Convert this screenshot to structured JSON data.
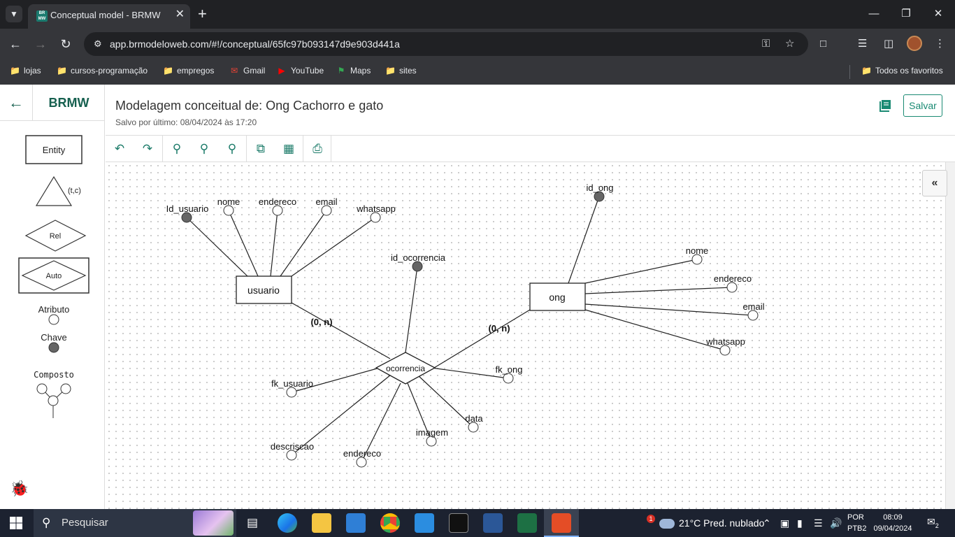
{
  "browser": {
    "tab_title": "Conceptual model - BRMW",
    "url": "app.brmodeloweb.com/#!/conceptual/65fc97b093147d9e903d441a",
    "bookmarks": [
      "lojas",
      "cursos-programação",
      "empregos",
      "Gmail",
      "YouTube",
      "Maps",
      "sites"
    ],
    "all_bookmarks": "Todos os favoritos"
  },
  "app": {
    "brand": "BRMW",
    "title": "Modelagem conceitual de: Ong Cachorro e gato",
    "subtitle": "Salvo por último: 08/04/2024 às 17:20",
    "save_label": "Salvar"
  },
  "palette": {
    "entity": "Entity",
    "specialization": "(t,c)",
    "relationship": "Rel",
    "associative": "Auto",
    "attribute": "Atributo",
    "key": "Chave",
    "composite": "Composto"
  },
  "diagram": {
    "entities": {
      "usuario": "usuario",
      "ong": "ong"
    },
    "relationship": "ocorrencia",
    "cardinalities": {
      "usuario": "(0, n)",
      "ong": "(0, n)"
    },
    "attributes": {
      "usuario": [
        "Id_usuario",
        "nome",
        "endereco",
        "email",
        "whatsapp"
      ],
      "ong": [
        "id_ong",
        "nome",
        "endereco",
        "email",
        "whatsapp"
      ],
      "ocorrencia": [
        "id_ocorrencia",
        "fk_usuario",
        "fk_ong",
        "data",
        "imagem",
        "endereco",
        "descriscao"
      ]
    }
  },
  "taskbar": {
    "search": "Pesquisar",
    "weather": "21°C  Pred. nublado",
    "weather_badge": "1",
    "lang_1": "POR",
    "lang_2": "PTB2",
    "time": "08:09",
    "date": "09/04/2024",
    "notifications": "2"
  },
  "colors": {
    "accent": "#1a7a68",
    "key_attr": "#666666",
    "taskbar": "#1c2230"
  }
}
